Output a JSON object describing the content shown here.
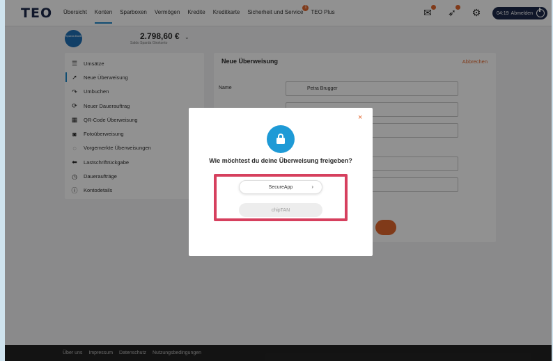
{
  "nav": {
    "logo": "TEO",
    "links": [
      "Übersicht",
      "Konten",
      "Sparboxen",
      "Vermögen",
      "Kredite",
      "Kreditkarte",
      "Sicherheit und Service",
      "TEO Plus"
    ],
    "active_index": 1,
    "security_badge": "1",
    "timer": "04:19",
    "logout_label": "Abmelden"
  },
  "account": {
    "bank_logo_text": "Sparda Bank",
    "amount": "2.798,60 €",
    "subtitle": "Saldo Sparda Girokonto"
  },
  "sidebar": {
    "items": [
      {
        "label": "Umsätze",
        "icon": "list-icon"
      },
      {
        "label": "Neue Überweisung",
        "icon": "send-arrow-icon",
        "active": true
      },
      {
        "label": "Umbuchen",
        "icon": "rebook-icon"
      },
      {
        "label": "Neuer Dauerauftrag",
        "icon": "recurring-icon"
      },
      {
        "label": "QR-Code Überweisung",
        "icon": "qr-code-icon"
      },
      {
        "label": "Fotoüberweisung",
        "icon": "camera-icon"
      },
      {
        "label": "Vorgemerkte Überweisungen",
        "icon": "pending-icon"
      },
      {
        "label": "Lastschriftrückgabe",
        "icon": "return-icon"
      },
      {
        "label": "Daueraufträge",
        "icon": "clock-icon"
      },
      {
        "label": "Kontodetails",
        "icon": "info-icon"
      }
    ]
  },
  "panel": {
    "title": "Neue Überweisung",
    "cancel_label": "Abbrechen",
    "name_label": "Name",
    "name_value": "Petra Brugger"
  },
  "modal": {
    "question": "Wie möchtest du deine Überweisung freigeben?",
    "option_secureapp": "SecureApp",
    "option_chiptan": "chipTAN",
    "close_symbol": "×",
    "accent_color": "#1e9ad6",
    "highlight_color": "#d6405e"
  },
  "footer": {
    "links": [
      "Über uns",
      "Impressum",
      "Datenschutz",
      "Nutzungsbedingungen"
    ]
  }
}
